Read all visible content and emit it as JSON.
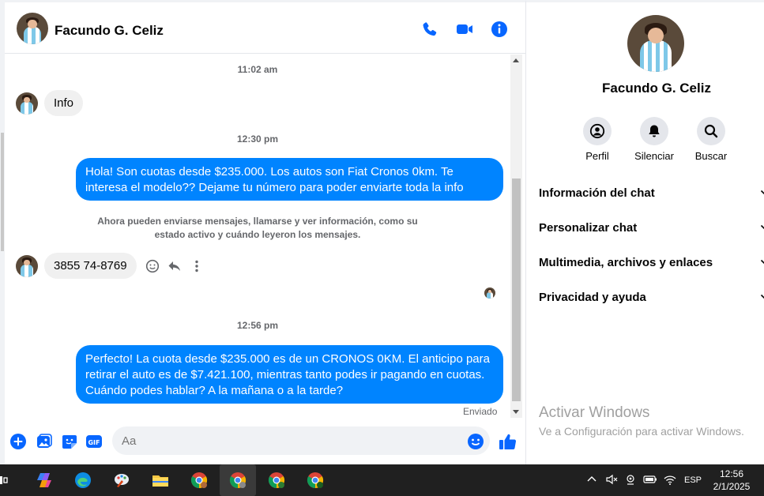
{
  "contact": {
    "name": "Facundo G. Celiz"
  },
  "messages": {
    "ts1": "11:02 am",
    "msg_in_1": "Info",
    "ts2": "12:30 pm",
    "msg_out_1": "Hola! Son cuotas desde $235.000. Los autos son Fiat Cronos 0km. Te interesa el modelo?? Dejame tu número para poder enviarte toda la info",
    "system_notice": "Ahora pueden enviarse mensajes, llamarse y ver información, como su estado activo y cuándo leyeron los mensajes.",
    "msg_in_2": "3855 74-8769",
    "ts3": "12:56 pm",
    "msg_out_2": "Perfecto! La cuota desde $235.000 es de un CRONOS 0KM. El anticipo para retirar el auto es de $7.421.100, mientras tanto podes ir pagando en cuotas. Cuándo podes hablar? A la mañana o a la tarde?",
    "status": "Enviado"
  },
  "composer": {
    "placeholder": "Aa"
  },
  "panel": {
    "name": "Facundo G. Celiz",
    "buttons": [
      "Perfil",
      "Silenciar",
      "Buscar"
    ],
    "sections": [
      "Información del chat",
      "Personalizar chat",
      "Multimedia, archivos y enlaces",
      "Privacidad y ayuda"
    ]
  },
  "watermark": {
    "title": "Activar Windows",
    "subtitle": "Ve a Configuración para activar Windows."
  },
  "taskbar": {
    "language": "ESP",
    "time": "12:56",
    "date": "2/1/2025"
  },
  "colors": {
    "accent": "#0084ff",
    "icon_blue": "#0866ff"
  },
  "icons": [
    "phone-icon",
    "video-icon",
    "info-icon",
    "emoji-icon",
    "reply-icon",
    "more-icon",
    "plus-icon",
    "image-icon",
    "sticker-icon",
    "gif-icon",
    "like-icon",
    "profile-icon",
    "bell-icon",
    "search-icon"
  ]
}
